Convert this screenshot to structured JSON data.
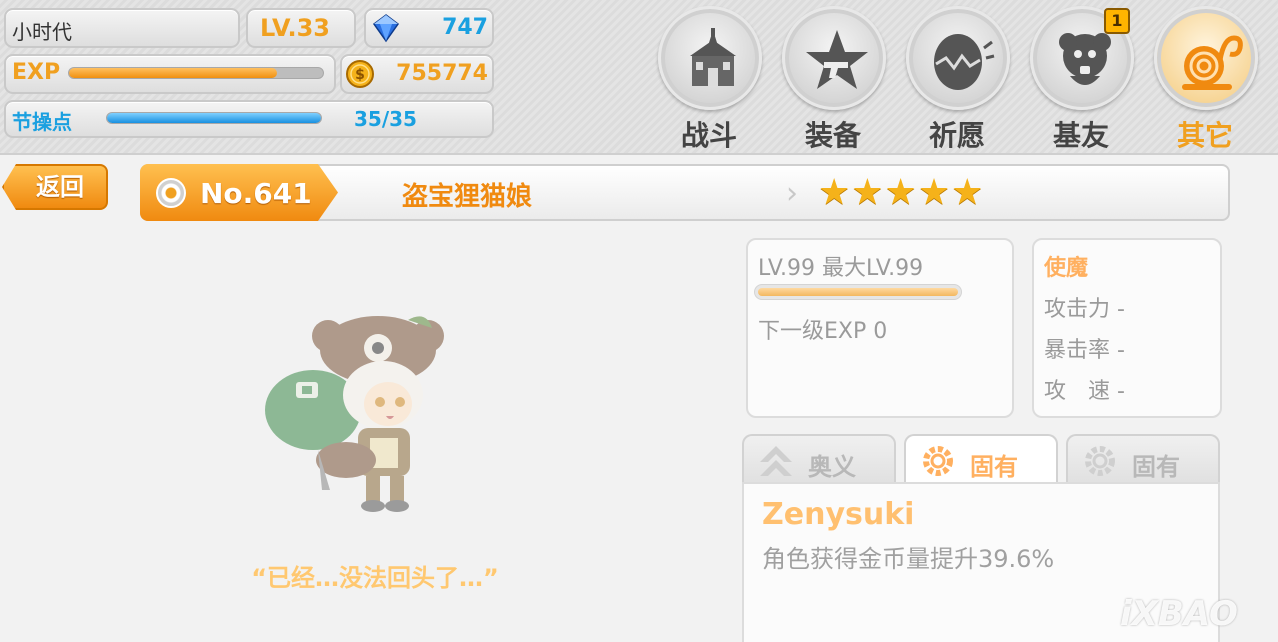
{
  "player": {
    "name": "小时代",
    "level": "LV.33",
    "gems": "747",
    "exp_label": "EXP",
    "exp_fill": 0.82,
    "coins": "755774",
    "stamina_label": "节操点",
    "stamina_value": "35/35",
    "stamina_fill": 1.0
  },
  "nav": [
    {
      "label": "战斗",
      "icon": "castle-icon",
      "active": false
    },
    {
      "label": "装备",
      "icon": "star-gun-icon",
      "active": false
    },
    {
      "label": "祈愿",
      "icon": "egg-icon",
      "active": false
    },
    {
      "label": "基友",
      "icon": "friend-mascot-icon",
      "active": false,
      "badge": "1"
    },
    {
      "label": "其它",
      "icon": "snail-icon",
      "active": true
    }
  ],
  "header": {
    "back_label": "返回",
    "number": "No.641",
    "character_name": "盗宝狸猫娘",
    "stars": "★★★★★",
    "star_count": 5
  },
  "character": {
    "quote": "“已经…没法回头了…”"
  },
  "level_card": {
    "level_text": "LV.99 最大LV.99",
    "level_fill": 1.0,
    "next_exp": "下一级EXP 0"
  },
  "stats_card": {
    "title": "使魔",
    "attack": "攻击力 -",
    "crit": "暴击率 -",
    "speed": "攻　速 -"
  },
  "tabs": [
    {
      "label": "奥义",
      "icon": "chevron-up-icon",
      "active": false
    },
    {
      "label": "固有",
      "icon": "gear-icon",
      "active": true
    },
    {
      "label": "固有",
      "icon": "gear-icon",
      "active": false
    }
  ],
  "skill": {
    "name": "Zenysuki",
    "description": "角色获得金币量提升39.6%"
  },
  "watermark": "iXBAO",
  "colors": {
    "accent_orange": "#f0a020",
    "accent_blue": "#1aa0e0",
    "star_gold": "#f5b21a"
  }
}
